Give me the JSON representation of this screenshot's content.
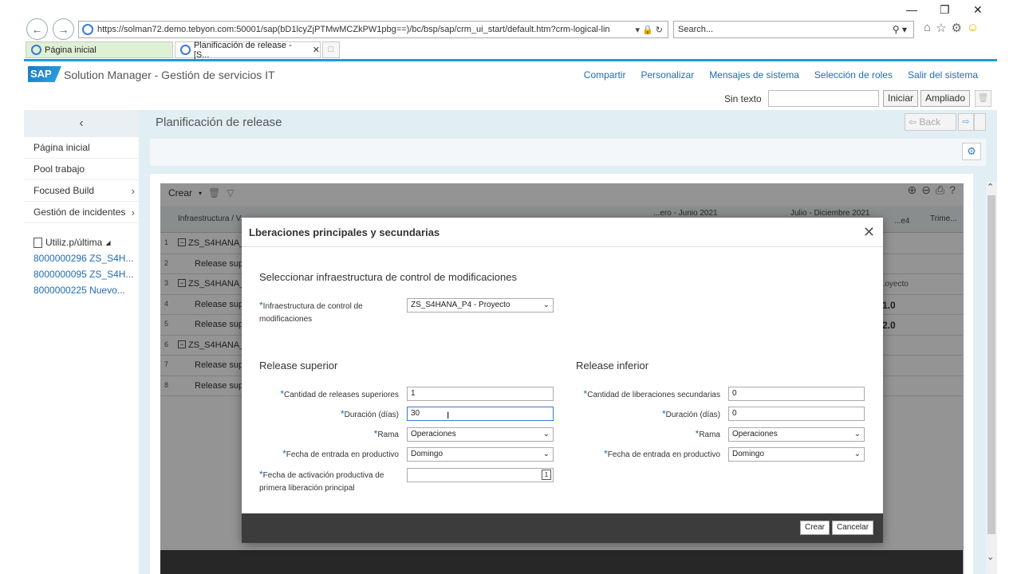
{
  "browser": {
    "url": "https://solman72.demo.tebyon.com:50001/sap(bD1lcyZjPTMwMCZkPW1pbg==)/bc/bsp/sap/crm_ui_start/default.htm?crm-logical-lin",
    "search_placeholder": "Search...",
    "tabs": [
      {
        "label": "Página inicial"
      },
      {
        "label": "Planificación de release - [S..."
      }
    ]
  },
  "header": {
    "logo": "SAP",
    "app_title": "Solution Manager - Gestión de servicios IT",
    "links": [
      "Compartir",
      "Personalizar",
      "Mensajes de sistema",
      "Selección de roles",
      "Salir del sistema"
    ]
  },
  "search_row": {
    "label": "Sin texto",
    "start_button": "Iniciar",
    "advanced_button": "Ampliado"
  },
  "left_nav": {
    "items": [
      "Página inicial",
      "Pool trabajo",
      "Focused Build",
      "Gestión de incidentes"
    ],
    "recent_title": "Utiliz.p/última",
    "recent_items": [
      "8000000296 ZS_S4H...",
      "8000000095 ZS_S4H...",
      "8000000225 Nuevo..."
    ]
  },
  "page": {
    "title": "Planificación de release",
    "back_label": "Back"
  },
  "grid": {
    "create_label": "Crear",
    "col_infra": "Infraestructura / V...",
    "col_period1": "...ero - Junio 2021",
    "col_period2": "Julio - Diciembre 2021",
    "col_trim": "Trime...",
    "col_trim_short": "...e4",
    "rows": [
      {
        "num": "1",
        "type": "group",
        "label": "ZS_S4HANA_"
      },
      {
        "num": "2",
        "type": "sub",
        "label": "Release supe"
      },
      {
        "num": "3",
        "type": "group",
        "label": "ZS_S4HANA_",
        "right": "...oyecto"
      },
      {
        "num": "4",
        "type": "sub",
        "label": "Release supe",
        "right": "1.0"
      },
      {
        "num": "5",
        "type": "sub",
        "label": "Release supe",
        "right": "2.0"
      },
      {
        "num": "6",
        "type": "group",
        "label": "ZS_S4HANA_"
      },
      {
        "num": "7",
        "type": "sub",
        "label": "Release supe"
      },
      {
        "num": "8",
        "type": "sub",
        "label": "Release supe"
      }
    ]
  },
  "dialog": {
    "title": "Lberaciones principales y secundarias",
    "infra_section": "Seleccionar infraestructura de control de modificaciones",
    "infra_label": "Infraestructura de control de modificaciones",
    "infra_value": "ZS_S4HANA_P4 - Proyecto",
    "superior": {
      "title": "Release superior",
      "qty_label": "Cantidad de releases superiores",
      "qty_value": "1",
      "dur_label": "Duración (días)",
      "dur_value": "30",
      "branch_label": "Rama",
      "branch_value": "Operaciones",
      "prod_label": "Fecha de entrada en productivo",
      "prod_value": "Domingo",
      "activation_label": "Fecha de activación productiva de primera liberación principal",
      "activation_value": ""
    },
    "inferior": {
      "title": "Release inferior",
      "qty_label": "Cantidad de liberaciones secundarias",
      "qty_value": "0",
      "dur_label": "Duración (días)",
      "dur_value": "0",
      "branch_label": "Rama",
      "branch_value": "Operaciones",
      "prod_label": "Fecha de entrada en productivo",
      "prod_value": "Domingo"
    },
    "create_button": "Crear",
    "cancel_button": "Cancelar"
  },
  "colors": {
    "accent": "#1f9ad6",
    "link": "#1f6bb5",
    "tab_active": "#dff1d4",
    "main_bg": "#e1eef3"
  }
}
